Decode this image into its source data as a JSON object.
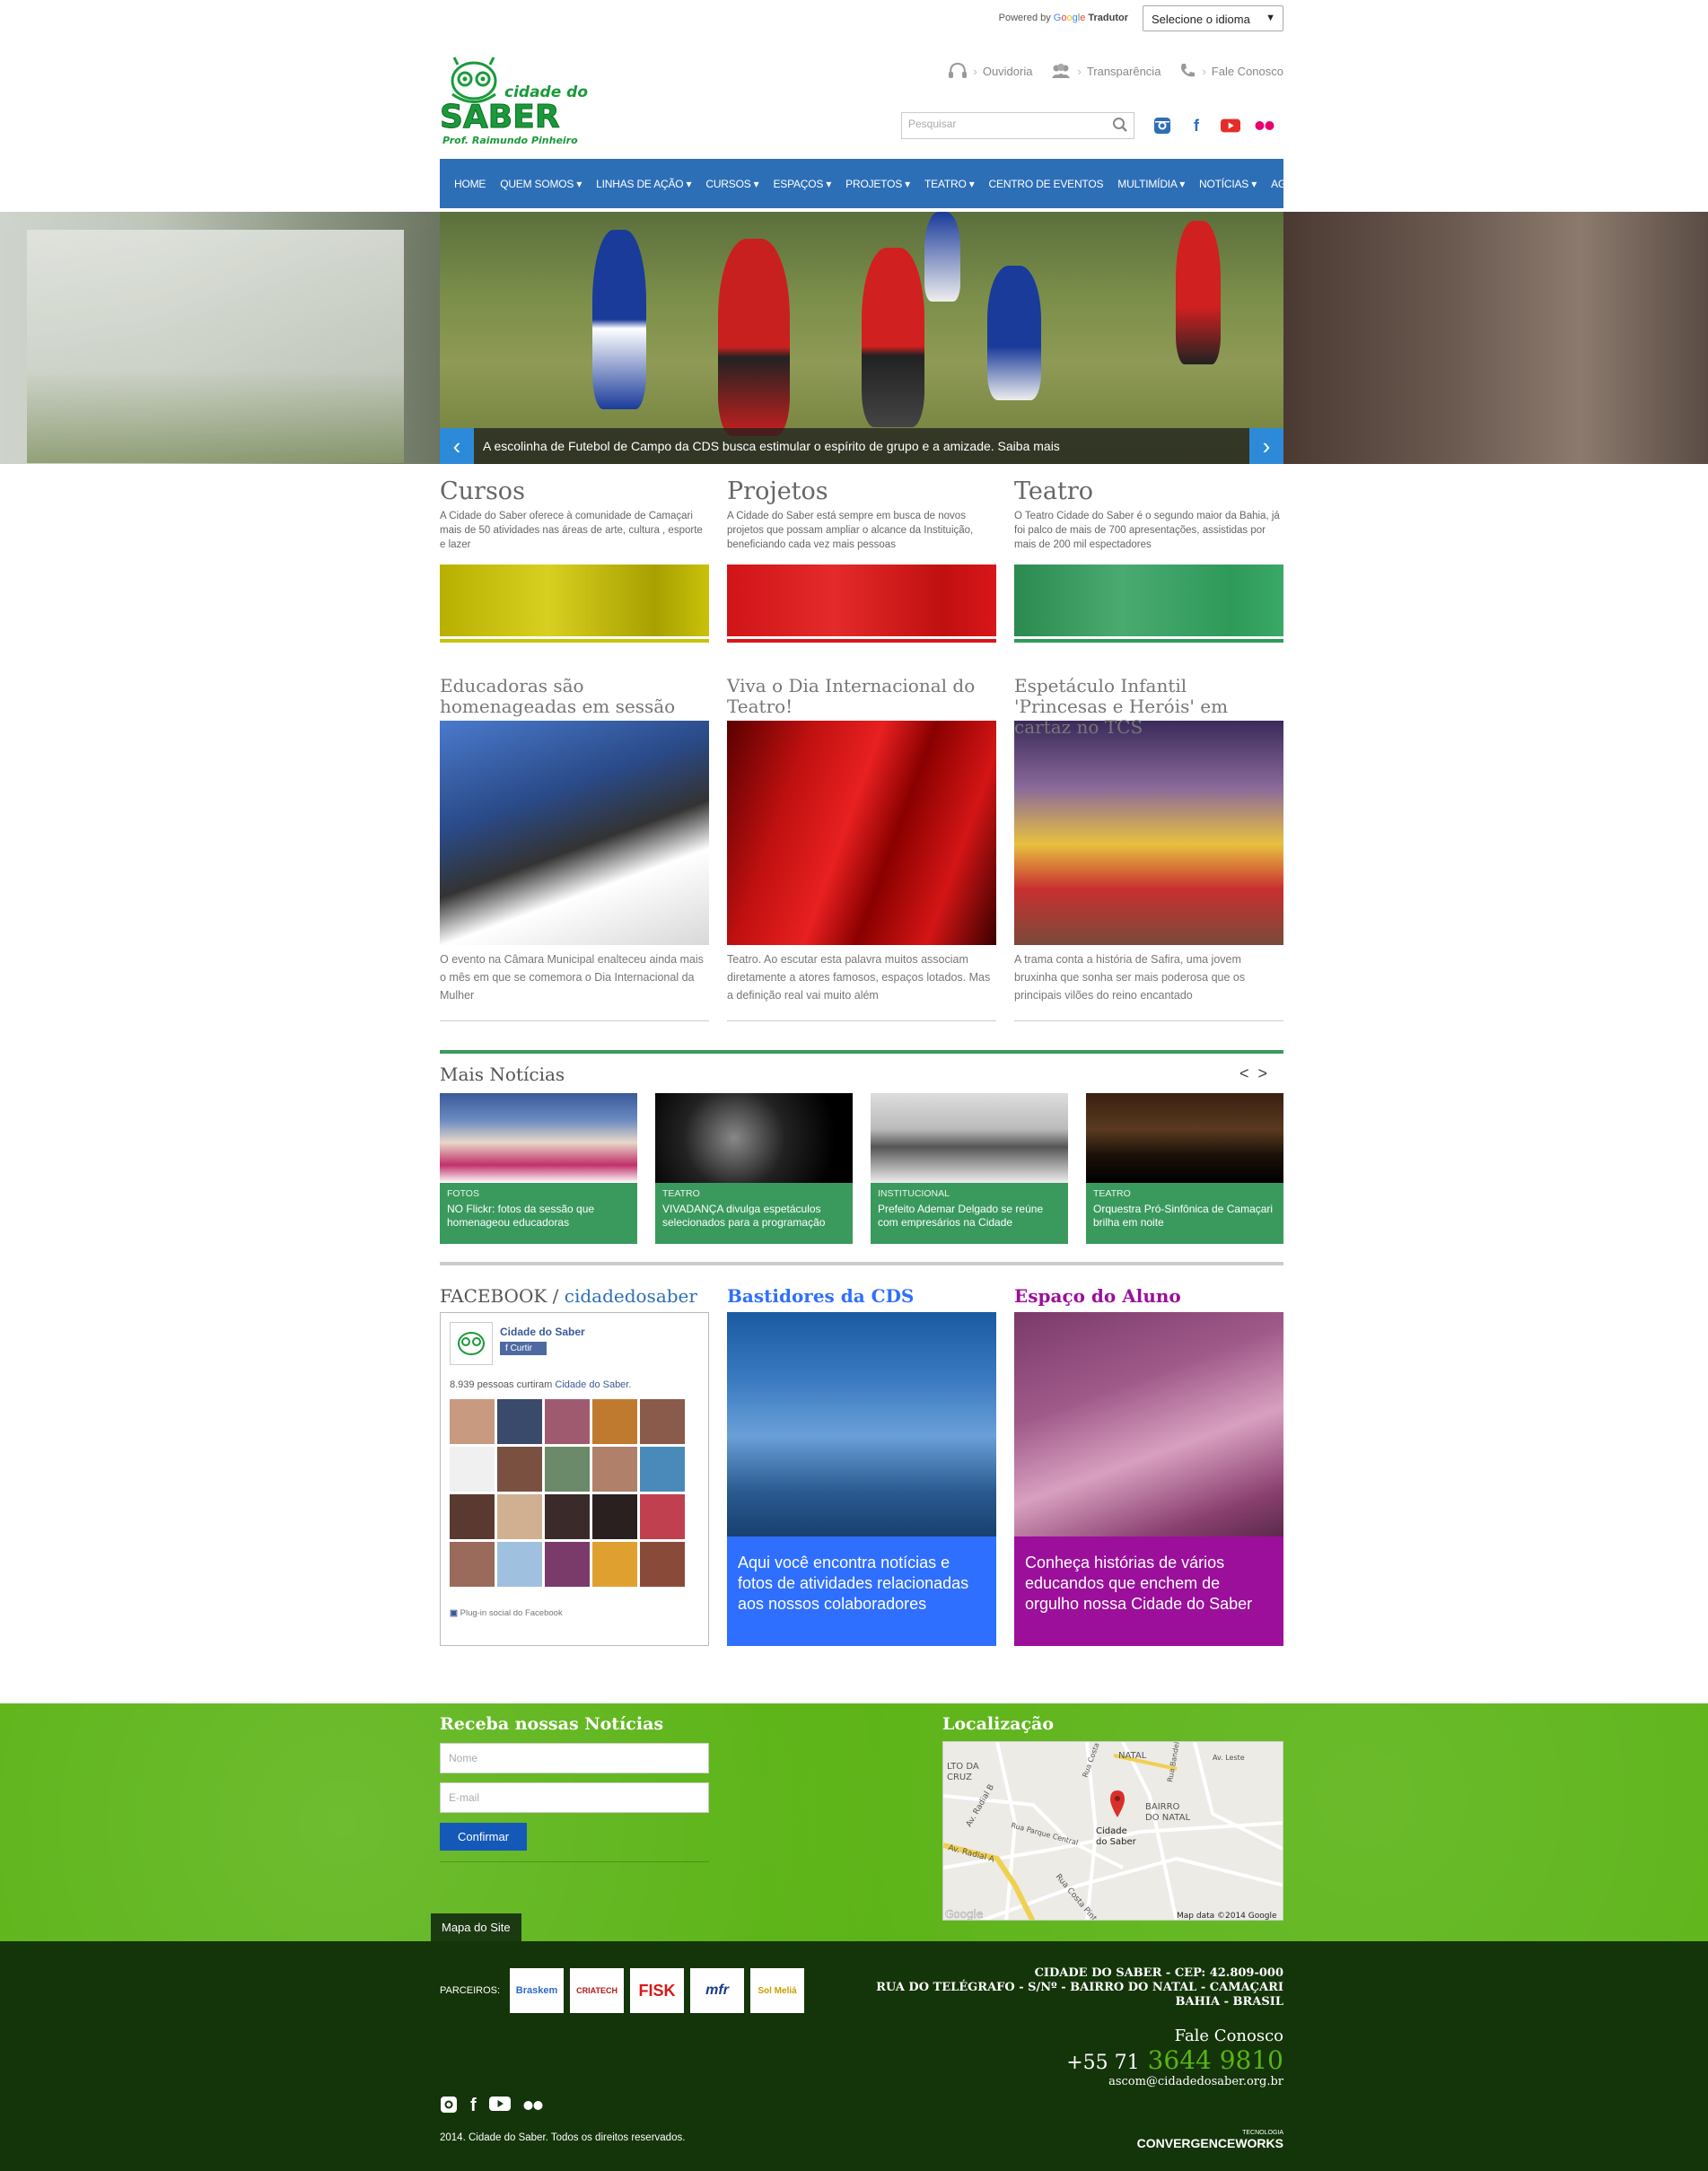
{
  "topbar": {
    "powered_by": "Powered by",
    "google": [
      "G",
      "o",
      "o",
      "g",
      "l",
      "e"
    ],
    "tradutor": "Tradutor",
    "language_select": "Selecione o idioma"
  },
  "header": {
    "logo_top": "cidade do",
    "logo_main": "SABER",
    "logo_sub": "Prof. Raimundo Pinheiro",
    "quicklinks": [
      "Ouvidoria",
      "Transparência",
      "Fale Conosco"
    ],
    "search_placeholder": "Pesquisar",
    "social_icons": [
      "instagram-icon",
      "facebook-icon",
      "youtube-icon",
      "flickr-icon"
    ]
  },
  "nav": {
    "items": [
      "HOME",
      "QUEM SOMOS ▾",
      "LINHAS DE AÇÃO ▾",
      "CURSOS ▾",
      "ESPAÇOS ▾",
      "PROJETOS ▾",
      "TEATRO ▾",
      "CENTRO DE EVENTOS",
      "MULTIMÍDIA ▾",
      "NOTÍCIAS ▾",
      "AGENDA"
    ]
  },
  "slider": {
    "caption": "A escolinha de Futebol de Campo da CDS busca estimular o espírito de grupo e a amizade. Saiba mais",
    "prev": "‹",
    "next": "›"
  },
  "features": [
    {
      "title": "Cursos",
      "text": "A Cidade do Saber oferece à comunidade de Camaçari mais de 50 atividades nas áreas de arte, cultura , esporte e lazer",
      "color": "#c8c20a"
    },
    {
      "title": "Projetos",
      "text": "A Cidade do Saber está sempre em busca de novos projetos que possam ampliar o alcance da Instituição, beneficiando cada vez mais pessoas",
      "color": "#d8161a"
    },
    {
      "title": "Teatro",
      "text": "O Teatro Cidade do Saber é o segundo maior da Bahia, já foi palco de mais de 700 apresentações, assistidas por mais de 200 mil espectadores",
      "color": "#2e9a5a"
    }
  ],
  "news": [
    {
      "title": "Educadoras são homenageadas em sessão",
      "text": "O evento na Câmara Municipal enalteceu ainda mais o mês em que se comemora o Dia Internacional da Mulher"
    },
    {
      "title": "Viva o Dia Internacional do Teatro!",
      "text": "Teatro. Ao escutar esta palavra muitos associam diretamente a atores famosos, espaços lotados. Mas a definição real vai muito além"
    },
    {
      "title": "Espetáculo Infantil 'Princesas e Heróis' em cartaz no TCS",
      "text": "A trama conta a história de Safira, uma jovem bruxinha que sonha ser mais poderosa que os principais vilões do reino encantado"
    }
  ],
  "mais_noticias": {
    "title": "Mais Notícias",
    "prev": "<",
    "next": ">",
    "items": [
      {
        "category": "FOTOS",
        "title": "NO Flickr: fotos da sessão que homenageou educadoras"
      },
      {
        "category": "TEATRO",
        "title": "VIVADANÇA divulga espetáculos selecionados para a programação"
      },
      {
        "category": "INSTITUCIONAL",
        "title": "Prefeito Ademar Delgado se reúne com empresários na Cidade"
      },
      {
        "category": "TEATRO",
        "title": "Orquestra Pró-Sinfônica de Camaçari brilha em noite"
      }
    ]
  },
  "facebook": {
    "title": "FACEBOOK /",
    "username": "cidadedosaber",
    "page_name": "Cidade do Saber",
    "like_label": "Curtir",
    "count_text": "8.939 pessoas curtiram",
    "count_link": "Cidade do Saber",
    "plugin_text": "Plug-in social do Facebook"
  },
  "bastidores": {
    "title": "Bastidores da CDS",
    "text": "Aqui você encontra notícias e fotos de atividades relacionadas aos nossos colaboradores",
    "color": "#2f6fff"
  },
  "espaco_aluno": {
    "title": "Espaço do Aluno",
    "text": "Conheça histórias de vários educandos que enchem de orgulho nossa Cidade do Saber",
    "color": "#9b0f9b"
  },
  "newsletter": {
    "title": "Receba nossas Notícias",
    "name_placeholder": "Nome",
    "email_placeholder": "E-mail",
    "submit": "Confirmar"
  },
  "localizacao": {
    "title": "Localização",
    "map_labels": [
      "LTO DA",
      "CRUZ",
      "NATAL",
      "BAIRRO",
      "DO NATAL",
      "Cidade",
      "do Saber",
      "Av. Radial B",
      "Av. Radial A",
      "Rua Costa Pinto",
      "Rua Parque Central",
      "Av. Leste",
      "Rua Bandeira",
      "Rua Costa"
    ],
    "map_data": "Map data ©2014 Google",
    "google": "Google"
  },
  "sitemap": "Mapa do Site",
  "footer": {
    "partners_label": "PARCEIROS:",
    "partners": [
      "Braskem",
      "CRIATECH",
      "FISK",
      "mfr",
      "Sol Meliá"
    ],
    "address": [
      "CIDADE DO SABER - CEP: 42.809-000",
      "RUA DO TELÉGRAFO - S/Nº - BAIRRO DO NATAL - CAMAÇARI",
      "BAHIA - BRASIL"
    ],
    "fale_conosco": "Fale Conosco",
    "phone_prefix": "+55 71",
    "phone_number": "3644 9810",
    "email": "ascom@cidadedosaber.org.br",
    "copyright": "2014. Cidade do Saber. Todos os direitos reservados.",
    "tech_label": "TECNOLOGIA",
    "tech_brand": "CONVERGENCEWORKS"
  }
}
